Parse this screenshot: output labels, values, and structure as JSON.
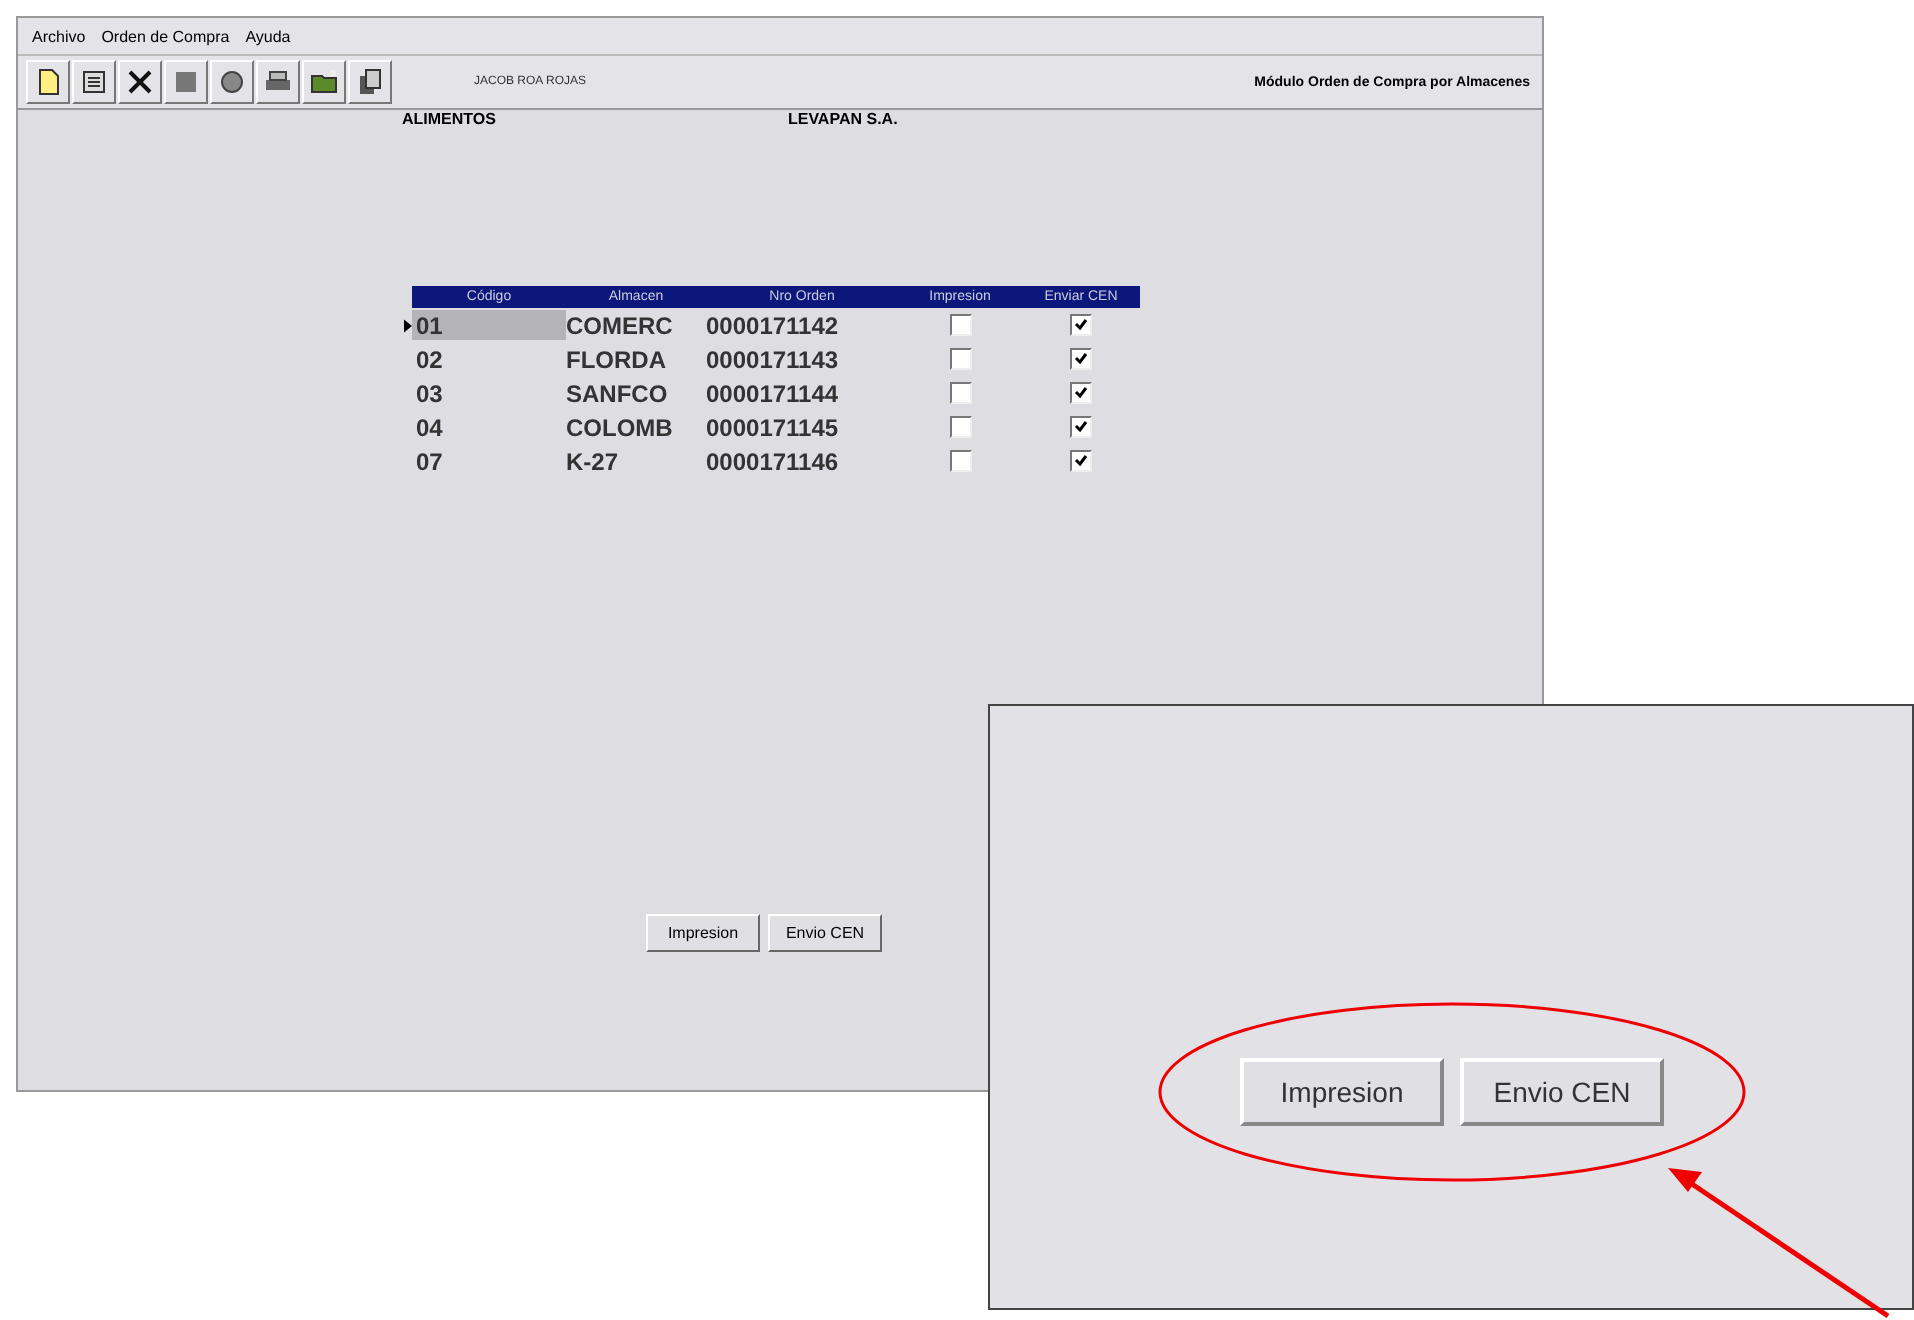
{
  "menu": [
    "Archivo",
    "Orden de Compra",
    "Ayuda"
  ],
  "toolbar": {
    "user": "JACOB ROA ROJAS",
    "module_title": "Módulo Orden de Compra por Almacenes"
  },
  "header": {
    "category": "ALIMENTOS",
    "company": "LEVAPAN S.A."
  },
  "table": {
    "columns": [
      "Código",
      "Almacen",
      "Nro Orden",
      "Impresion",
      "Enviar CEN"
    ],
    "rows": [
      {
        "codigo": "01",
        "almacen": "COMERC",
        "orden": "0000171142",
        "impresion": false,
        "enviar": true,
        "selected": true
      },
      {
        "codigo": "02",
        "almacen": "FLORDA",
        "orden": "0000171143",
        "impresion": false,
        "enviar": true,
        "selected": false
      },
      {
        "codigo": "03",
        "almacen": "SANFCO",
        "orden": "0000171144",
        "impresion": false,
        "enviar": true,
        "selected": false
      },
      {
        "codigo": "04",
        "almacen": "COLOMB",
        "orden": "0000171145",
        "impresion": false,
        "enviar": true,
        "selected": false
      },
      {
        "codigo": "07",
        "almacen": "K-27",
        "orden": "0000171146",
        "impresion": false,
        "enviar": true,
        "selected": false
      }
    ]
  },
  "buttons": [
    "Impresion",
    "Envio CEN"
  ],
  "inset": {
    "buttons": [
      "Impresion",
      "Envio CEN"
    ]
  }
}
